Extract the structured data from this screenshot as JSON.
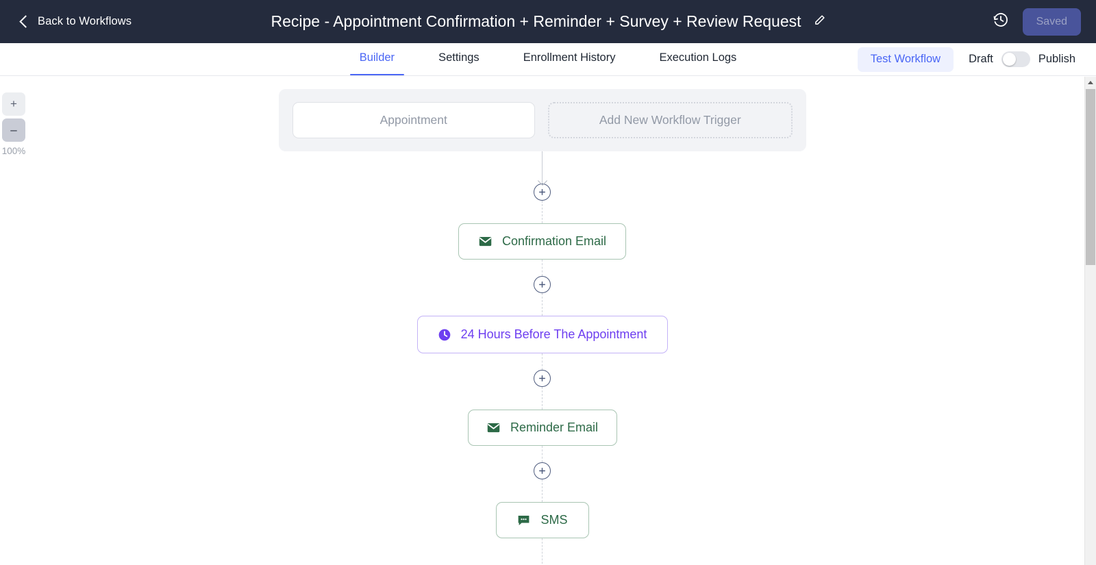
{
  "header": {
    "back_label": "Back to Workflows",
    "back_icon": "chevron-left-icon",
    "title": "Recipe - Appointment Confirmation + Reminder + Survey + Review Request",
    "edit_icon": "pencil-icon",
    "history_icon": "clock-history-icon",
    "save_status": "Saved",
    "bg_color": "#242b3d",
    "saved_btn_color": "#49549b"
  },
  "tabbar": {
    "tabs": [
      {
        "label": "Builder",
        "active": true
      },
      {
        "label": "Settings",
        "active": false
      },
      {
        "label": "Enrollment History",
        "active": false
      },
      {
        "label": "Execution Logs",
        "active": false
      }
    ],
    "test_workflow_label": "Test Workflow",
    "draft_label": "Draft",
    "publish_label": "Publish",
    "toggle_state": "off",
    "accent_color": "#4a66f5"
  },
  "canvas": {
    "zoom": {
      "zoom_in_label": "+",
      "zoom_out_label": "–",
      "level": "100%"
    },
    "trigger": {
      "name": "Appointment",
      "add_label": "Add New Workflow Trigger"
    },
    "nodes": [
      {
        "label": "Confirmation Email",
        "type": "email",
        "icon": "envelope-icon",
        "color": "#2d6a47"
      },
      {
        "label": "24 Hours Before The Appointment",
        "type": "wait",
        "icon": "clock-filled-icon",
        "color": "#6d3ef0"
      },
      {
        "label": "Reminder Email",
        "type": "email",
        "icon": "envelope-icon",
        "color": "#2d6a47"
      },
      {
        "label": "SMS",
        "type": "sms",
        "icon": "chat-bubble-icon",
        "color": "#2d6a47"
      }
    ],
    "add_step_icon": "plus-circle-icon"
  },
  "scrollbar": {
    "up_arrow_icon": "caret-up-icon"
  }
}
